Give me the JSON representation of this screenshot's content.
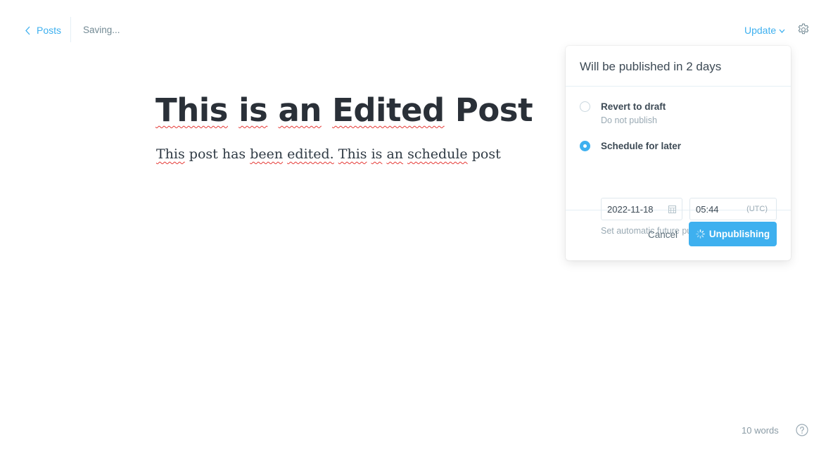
{
  "header": {
    "back_label": "Posts",
    "save_status": "Saving...",
    "publish_trigger": "Update"
  },
  "editor": {
    "title_words": [
      "This",
      "is",
      "an",
      "Edited",
      "Post"
    ],
    "body_words": [
      "This",
      "post",
      "has",
      "been",
      "edited.",
      "This",
      "is",
      "an",
      "schedule",
      "post"
    ]
  },
  "publish_menu": {
    "heading": "Will be published in 2 days",
    "options": [
      {
        "label": "Revert to draft",
        "description": "Do not publish",
        "checked": false
      },
      {
        "label": "Schedule for later",
        "description": "",
        "checked": true
      }
    ],
    "date_value": "2022-11-18",
    "time_value": "05:44",
    "timezone": "(UTC)",
    "hint": "Set automatic future publish date",
    "cancel_label": "Cancel",
    "primary_label": "Unpublishing"
  },
  "footer": {
    "word_count": "10 words"
  },
  "colors": {
    "accent": "#3eb0ef",
    "spellcheck": "#e53935"
  }
}
